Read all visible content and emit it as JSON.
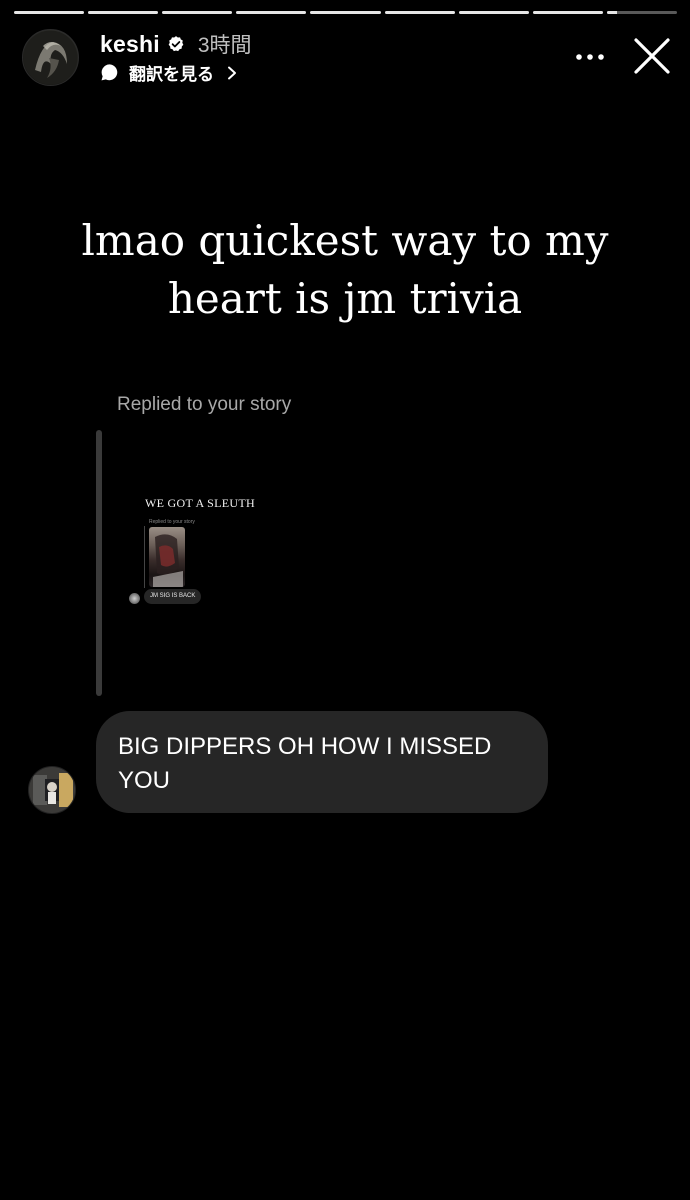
{
  "progress": {
    "segments": [
      1,
      1,
      1,
      1,
      1,
      1,
      1,
      1,
      0.15
    ],
    "current_index": 8
  },
  "header": {
    "username": "keshi",
    "verified": true,
    "time_ago": "3時間",
    "translate_label": "翻訳を見る",
    "icons": {
      "translate": "speech-bubble-icon",
      "more": "more-horizontal-icon",
      "close": "close-icon",
      "verified": "verified-badge-icon",
      "chevron": "chevron-right-icon"
    }
  },
  "story": {
    "caption": "lmao quickest way to my heart is jm trivia",
    "replied_label": "Replied to your story",
    "nested_story": {
      "caption": "WE GOT A SLEUTH",
      "replied_label": "Replied to your story",
      "message": "JM SIG IS BACK"
    },
    "reply_message": "BIG DIPPERS OH HOW I MISSED YOU"
  },
  "colors": {
    "background": "#000000",
    "bubble": "#262626",
    "secondary_text": "#a8a8a8",
    "reply_bar": "#3a3a3a"
  }
}
